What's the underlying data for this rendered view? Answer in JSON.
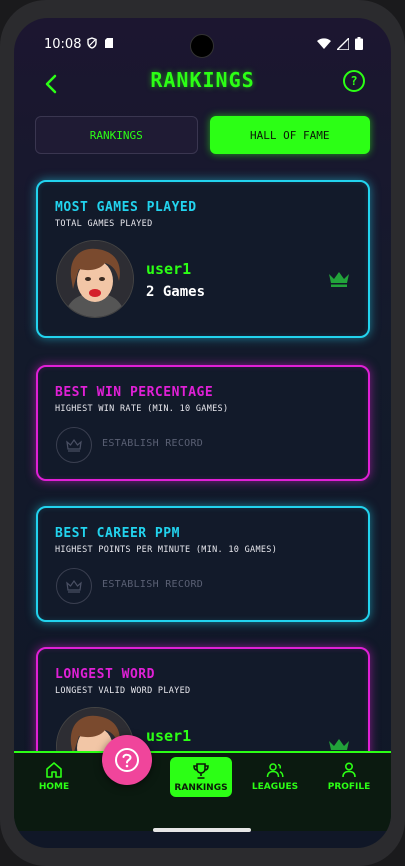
{
  "status": {
    "time": "10:08"
  },
  "header": {
    "title": "RANKINGS",
    "help_symbol": "?"
  },
  "tabs": [
    {
      "label": "RANKINGS",
      "active": false
    },
    {
      "label": "HALL OF FAME",
      "active": true
    }
  ],
  "cards": [
    {
      "title": "MOST GAMES PLAYED",
      "subtitle": "TOTAL GAMES PLAYED",
      "holder": "user1",
      "value": "2 Games",
      "accent": "#22d3ee"
    },
    {
      "title": "BEST WIN PERCENTAGE",
      "subtitle": "HIGHEST WIN RATE (MIN. 10 GAMES)",
      "empty_label": "ESTABLISH RECORD",
      "accent": "#e020d6"
    },
    {
      "title": "BEST CAREER PPM",
      "subtitle": "HIGHEST POINTS PER MINUTE (MIN. 10 GAMES)",
      "empty_label": "ESTABLISH RECORD",
      "accent": "#22d3ee"
    },
    {
      "title": "LONGEST WORD",
      "subtitle": "LONGEST VALID WORD PLAYED",
      "holder": "user1",
      "accent": "#e020d6"
    }
  ],
  "nav": [
    {
      "label": "HOME",
      "icon": "home-icon"
    },
    {
      "label": "RANKINGS",
      "icon": "trophy-icon",
      "active": true
    },
    {
      "label": "LEAGUES",
      "icon": "users-icon"
    },
    {
      "label": "PROFILE",
      "icon": "person-icon"
    }
  ],
  "colors": {
    "accent_green": "#2cff15",
    "fab_pink": "#f0459b"
  }
}
